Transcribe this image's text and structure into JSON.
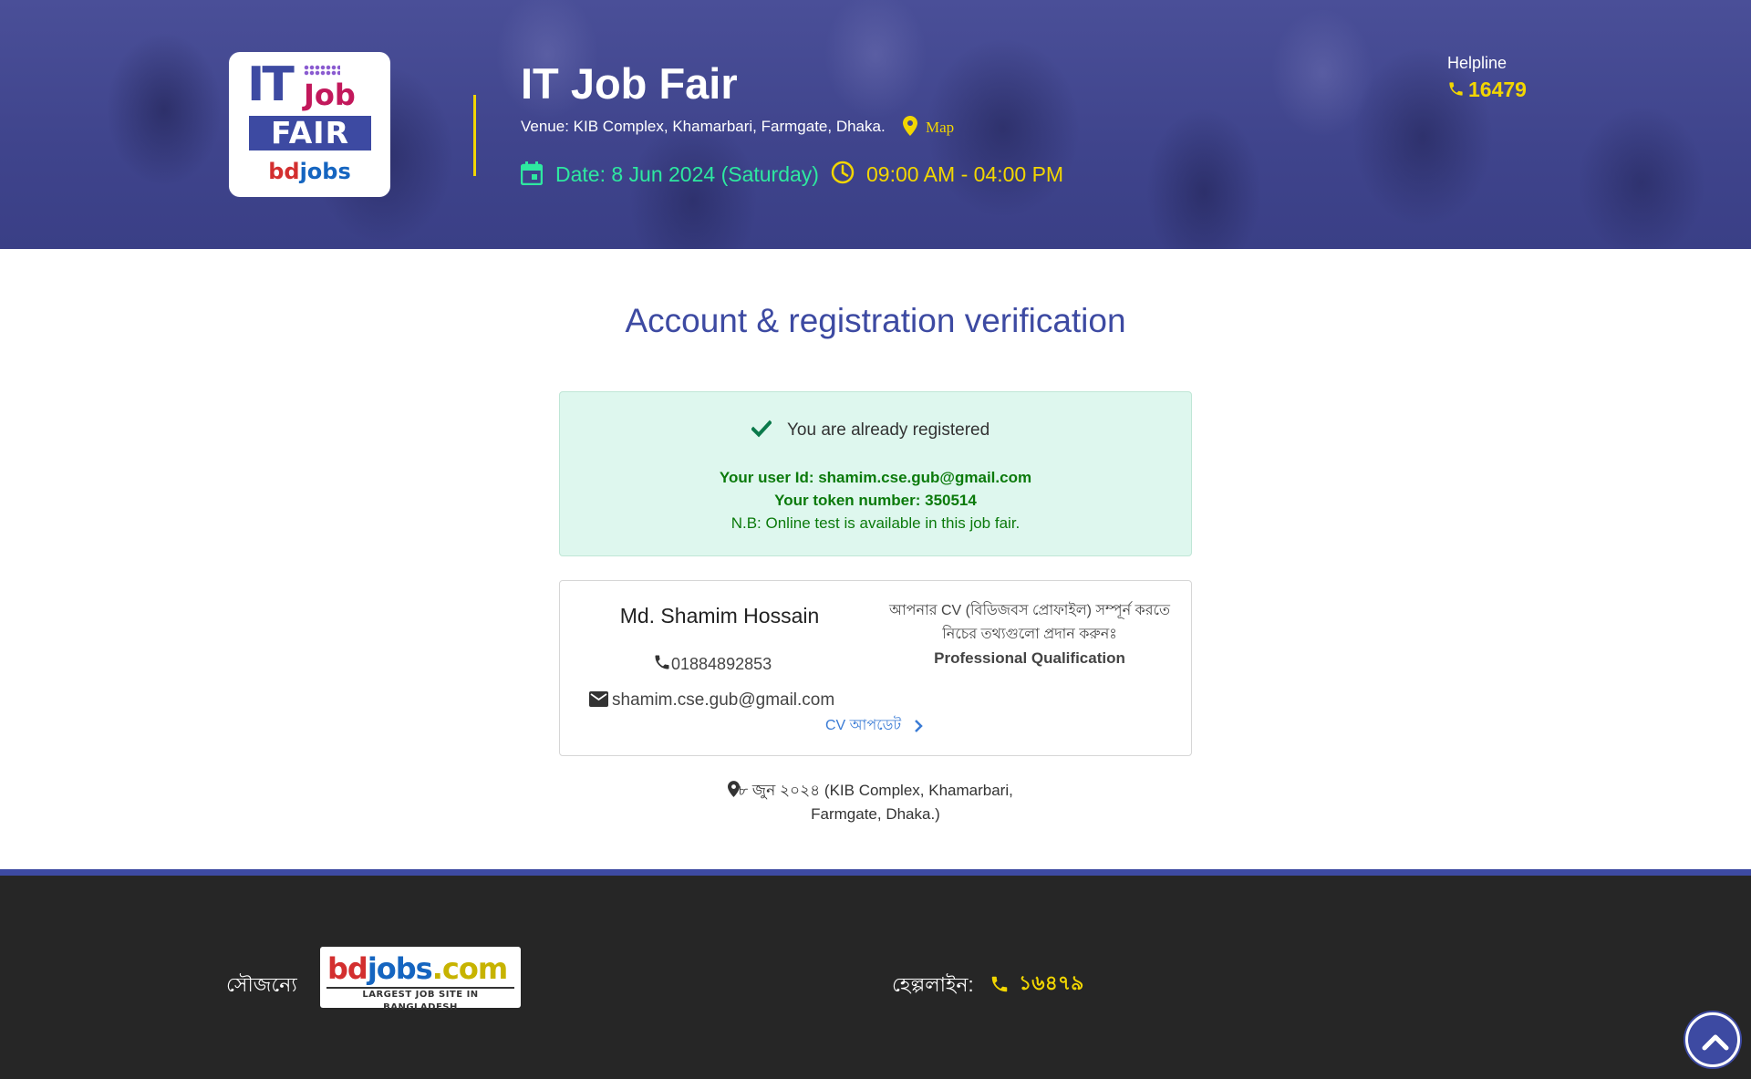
{
  "header": {
    "logo": {
      "it": "IT",
      "job": "Job",
      "fair": "FAIR",
      "brand_bd": "bd",
      "brand_jobs": "jobs"
    },
    "title": "IT Job Fair",
    "venue": "Venue: KIB Complex, Khamarbari, Farmgate, Dhaka.",
    "map_link": "Map",
    "date": "Date: 8 Jun 2024 (Saturday)",
    "time": "09:00 AM - 04:00 PM",
    "helpline_label": "Helpline",
    "helpline_number": "16479",
    "colors": {
      "background": "#4a4f98",
      "accent_yellow": "#f2d600",
      "accent_green": "#2ee8a0"
    }
  },
  "main": {
    "heading": "Account & registration verification",
    "status": {
      "message": "You are already registered",
      "user_id": "Your user Id: shamim.cse.gub@gmail.com",
      "token": "Your token number: 350514",
      "note": "N.B: Online test is available in this job fair."
    },
    "profile": {
      "name": "Md. Shamim Hossain",
      "phone": "01884892853",
      "email": "shamim.cse.gub@gmail.com",
      "cv_update_label": "CV আপডেট",
      "cv_note": "আপনার CV (বিডিজবস প্রোফাইল) সম্পূর্ন করতে নিচের তথ্যগুলো প্রদান করুনঃ",
      "cv_qualification": "Professional Qualification"
    },
    "event_location": "৮ জুন ২০২৪ (KIB Complex, Khamarbari, Farmgate, Dhaka.)"
  },
  "footer": {
    "courtesy_label": "সৌজন্যে",
    "logo_bd": "bd",
    "logo_jobs": "jobs",
    "logo_com": ".com",
    "logo_tagline": "LARGEST JOB SITE IN BANGLADESH",
    "helpline_label": "হেল্পলাইন:",
    "helpline_number": "১৬৪৭৯",
    "colors": {
      "background": "#262626",
      "top_bar": "#3d4aa2"
    }
  },
  "icons": [
    "calendar-icon",
    "clock-icon",
    "map-pin-icon",
    "phone-icon",
    "check-icon",
    "mail-icon",
    "chevron-right-icon",
    "chevron-up-icon"
  ]
}
